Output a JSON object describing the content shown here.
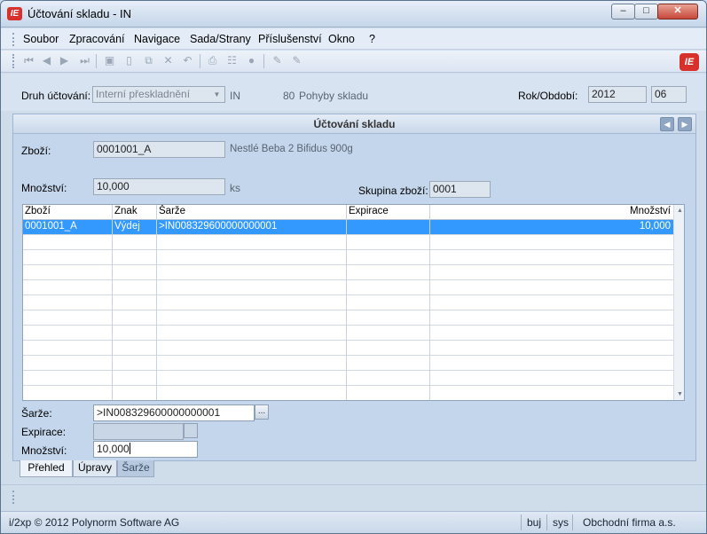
{
  "window": {
    "title": "Účtování skladu - IN",
    "logo": "IE",
    "minimize_icon": "minimize-icon",
    "maximize_icon": "maximize-icon",
    "close_icon": "close-icon"
  },
  "menu": {
    "items": [
      "Soubor",
      "Zpracování",
      "Navigace",
      "Sada/Strany",
      "Příslušenství",
      "Okno",
      "?"
    ]
  },
  "toolbar": {
    "icons": [
      "first-record-icon",
      "previous-record-icon",
      "next-record-icon",
      "last-record-icon",
      "save-icon",
      "new-icon",
      "copy-icon",
      "delete-icon",
      "undo-icon",
      "print-icon",
      "tree-icon",
      "info-icon",
      "edit-icon",
      "edit-disabled-icon"
    ],
    "logo": "IE"
  },
  "header": {
    "druh_label": "Druh účtování:",
    "druh_value": "Interní přeskladnění",
    "code": "IN",
    "number": "80",
    "description": "Pohyby skladu",
    "rok_label": "Rok/Období:",
    "rok_value": "2012",
    "obdobi_value": "06"
  },
  "section": {
    "title": "Účtování skladu"
  },
  "form": {
    "zbozi_label": "Zboží:",
    "zbozi_value": "0001001_A",
    "zbozi_name": "Nestlé Beba 2 Bifidus 900g",
    "mnozstvi_label": "Množství:",
    "mnozstvi_value": "10,000",
    "mnozstvi_unit": "ks",
    "skupina_label": "Skupina zboží:",
    "skupina_value": "0001"
  },
  "grid": {
    "columns": [
      "Zboží",
      "Znak",
      "Šarže",
      "Expirace",
      "Množství"
    ],
    "rows": [
      {
        "zbozi": "0001001_A",
        "znak": "Výdej",
        "sarze": ">IN008329600000000001",
        "expirace": "",
        "mnozstvi": "10,000"
      }
    ],
    "empty_rows": 11
  },
  "detail": {
    "sarze_label": "Šarže:",
    "sarze_value": ">IN008329600000000001",
    "sarze_button": "...",
    "expirace_label": "Expirace:",
    "expirace_value": "",
    "mnozstvi_label": "Množství:",
    "mnozstvi_value": "10,000"
  },
  "tabs": [
    "Přehled",
    "Úpravy",
    "Šarže"
  ],
  "status": {
    "copyright": "i/2xp © 2012 Polynorm Software AG",
    "user": "buj",
    "system": "sys",
    "company": "Obchodní firma a.s."
  }
}
